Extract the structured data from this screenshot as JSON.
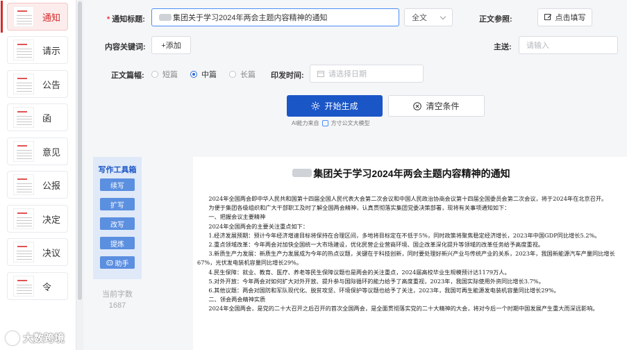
{
  "sidebar": {
    "items": [
      {
        "label": "通知",
        "active": true
      },
      {
        "label": "请示",
        "active": false
      },
      {
        "label": "公告",
        "active": false
      },
      {
        "label": "函",
        "active": false
      },
      {
        "label": "意见",
        "active": false
      },
      {
        "label": "公报",
        "active": false
      },
      {
        "label": "决定",
        "active": false
      },
      {
        "label": "决议",
        "active": false
      },
      {
        "label": "令",
        "active": false
      }
    ]
  },
  "form": {
    "title_label": "通知标题:",
    "title_required": "*",
    "title_value": "集团关于学习2024年两会主题内容精神的通知",
    "scope_select": "全文",
    "reference_label": "正文参照:",
    "reference_button": "点击填写",
    "keywords_label": "内容关键词:",
    "keywords_add": "+添加",
    "recipient_label": "主送:",
    "recipient_placeholder": "请输入",
    "length_label": "正文篇幅:",
    "length_options": [
      "短篇",
      "中篇",
      "长篇"
    ],
    "length_selected": "中篇",
    "date_label": "印发时间:",
    "date_placeholder": "请选择日期",
    "generate_button": "开始生成",
    "clear_button": "清空条件",
    "ai_note_prefix": "AI能力来自",
    "ai_note_model": "方寸公文大模型"
  },
  "toolbox": {
    "title": "写作工具箱",
    "buttons": [
      "续写",
      "扩写",
      "改写",
      "提炼",
      "助手"
    ],
    "word_count_label": "当前字数",
    "word_count": "1687"
  },
  "document": {
    "title": "集团关于学习2024年两会主题内容精神的通知",
    "paragraphs": [
      "　　2024年全国两会即中华人民共和国第十四届全国人民代表大会第二次会议和中国人民政治协商会议第十四届全国委员会第二次会议，将于2024年在北京召开。",
      "　　为便于集团各级组织和广大干部职工及时了解全国两会精神，认真贯彻落实集团党委决策部署，现将有关事项通知如下：",
      "　　一、把握会议主要精神",
      "　　2024年全国两会的主要关注重点如下：",
      "　　1.经济发展预期：预计今年经济增速目标将保持在合理区间，多地将目标定在不低于5%，同时政策将聚焦稳定经济增长，2023年中国GDP同比增长5.2%。",
      "　　2.重点领域改革：今年两会对加快全国统一大市场建设，优化民营企业营商环境、国企改革深化提升等领域的改革任务给予高度重视。",
      "　　3.新质生产力发展：新质生产力发展成为今年的热点议题，关键在于科技创新，同时要处理好新兴产业与传统产业的关系，2023年，我国新能源汽车产量同比增长67%，光伏发电装机容量同比增长29%。",
      "　　4.民生保障：就业、教育、医疗、养老等民生保障议题也是两会的关注重点，2024届高校毕业生规模预计达1179万人。",
      "　　5.对外开放：今年两会对如何扩大对外开放、提升参与国际循环的能力给予了高度重视，2023年，我国实际使用外资同比增长3.7%。",
      "　　6.其他议题：两会对国防和军队现代化、脱贫攻坚、环境保护等议题也给予了关注，2023年，我国可再生能源发电装机容量同比增长29%。",
      "　　二、领会两会精神实质",
      "　　2024年全国两会，是党的二十大召开之后召开的首次全国两会，是全面贯彻落实党的二十大精神的大会，将对今后一个时期中国发展产生重大而深远影响。"
    ]
  },
  "watermark": "大数跨境",
  "colors": {
    "accent": "#1b56c7",
    "active_red": "#d22b2b",
    "toolbox_bg": "#dfe9f8"
  }
}
